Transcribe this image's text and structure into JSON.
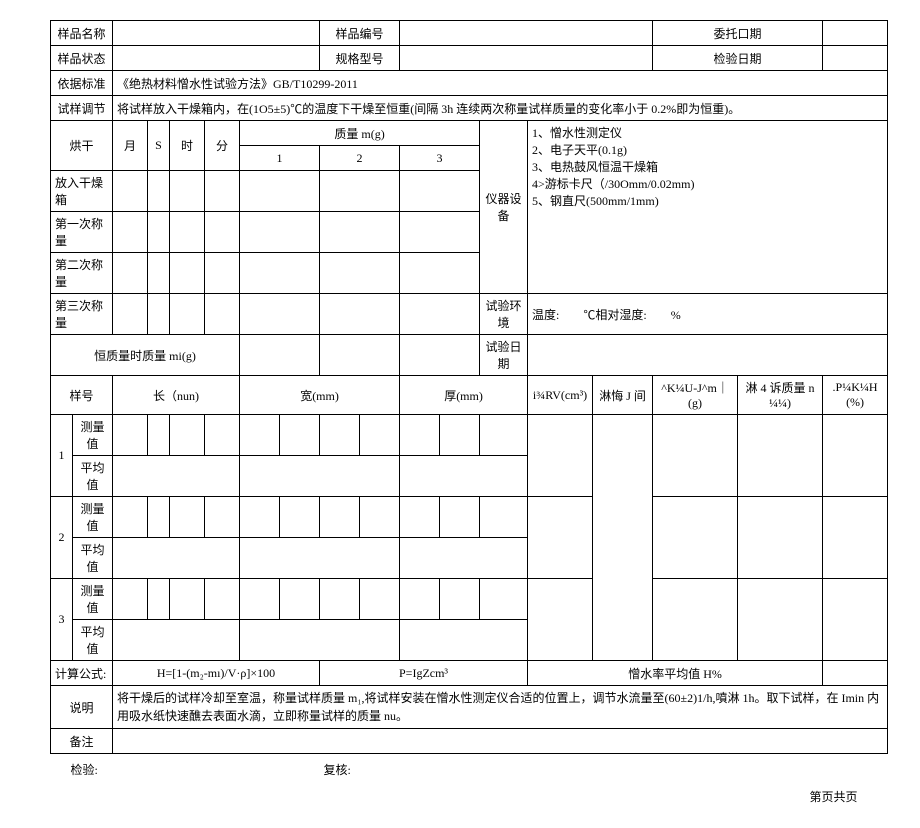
{
  "header": {
    "sample_name_label": "样品名称",
    "sample_no_label": "样品编号",
    "entrust_date_label": "委托口期",
    "sample_status_label": "样品状态",
    "spec_model_label": "规格型号",
    "inspect_date_label": "检验日期",
    "standard_label": "依据标准",
    "standard_value": "《绝热材料憎水性试验方法》GB/T10299-2011",
    "adjust_label": "试样调节",
    "adjust_value": "将试样放入干燥箱内，在(1O5±5)℃的温度下干燥至恒重(间隔 3h 连续两次称量试样质量的变化率小于 0.2%即为恒重)。"
  },
  "drying": {
    "dry_label": "烘干",
    "month": "月",
    "s": "S",
    "hour": "时",
    "minute": "分",
    "mass_label": "质量 m(g)",
    "c1": "1",
    "c2": "2",
    "c3": "3",
    "put_in_label": "放入干燥箱",
    "first_weigh_label": "第一次称量",
    "second_weigh_label": "第二次称量",
    "third_weigh_label": "第三次称量",
    "const_mass_label": "恒质量时质量 mi(g)"
  },
  "equipment": {
    "dev_label": "仪器设备",
    "item1": "1、憎水性测定仪",
    "item2": "2、电子天平(0.1g)",
    "item3": "3、电热鼓风恒温干燥箱",
    "item4": "4>游标卡尺（/30Omm/0.02mm)",
    "item5": "5、钢直尺(500mm/1mm)",
    "env_label": "试验环境",
    "env_value": "温度:  ℃相对湿度:  %",
    "test_date_label": "试验日期"
  },
  "dims": {
    "sample_no": "样号",
    "length": "长（nun)",
    "width": "宽(mm)",
    "thick": "厚(mm)",
    "vol": "i¾RV(cm³)",
    "spray_time": "淋悔 J 间",
    "mass_after": "^K¼U-J^m｜(g)",
    "mass_4h": "淋 4 诉质量 n¼¼)",
    "rate": ".P¼K¼H(%)",
    "measure": "测量值",
    "avg": "平均值",
    "r1": "1",
    "r2": "2",
    "r3": "3"
  },
  "formula": {
    "label": "计算公式:",
    "h": "H=[1-(m₂-mı)/V·ρ]×100",
    "p": "P=IgZcm³",
    "havg_label": "憎水率平均值 H%",
    "explain_label": "说明",
    "explain_value": "将干燥后的试样冷却至室温，称量试样质量 m₁,将试样安装在憎水性测定仪合适的位置上，调节水流量至(60±2)1/h,噴淋 1h。取下试样，在 Imin 内用吸水纸快速醮去表面水滴，立即称量试样的质量 nu。",
    "remark_label": "备注"
  },
  "footer": {
    "check": "检验:",
    "review": "复核:",
    "page": "第页共页"
  }
}
